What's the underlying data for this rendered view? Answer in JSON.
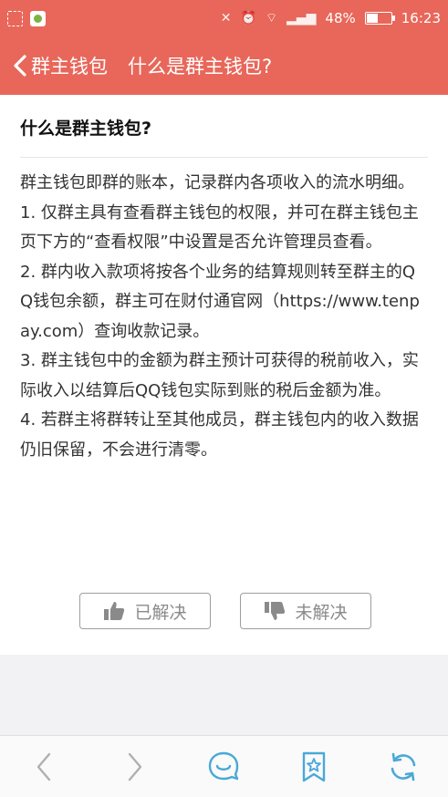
{
  "status_bar": {
    "battery": "48%",
    "battery_level": 0.48,
    "time": "16:23"
  },
  "nav": {
    "back_label": "群主钱包",
    "title": "什么是群主钱包?"
  },
  "article": {
    "title": "什么是群主钱包?",
    "paragraphs": [
      "群主钱包即群的账本，记录群内各项收入的流水明细。",
      "1. 仅群主具有查看群主钱包的权限，并可在群主钱包主页下方的“查看权限”中设置是否允许管理员查看。",
      "2. 群内收入款项将按各个业务的结算规则转至群主的QQ钱包余额，群主可在财付通官网（https://www.tenpay.com）查询收款记录。",
      "3. 群主钱包中的金额为群主预计可获得的税前收入，实际收入以结算后QQ钱包实际到账的税后金额为准。",
      "4. 若群主将群转让至其他成员，群主钱包内的收入数据仍旧保留，不会进行清零。"
    ]
  },
  "feedback": {
    "solved_label": "已解决",
    "unsolved_label": "未解决"
  },
  "colors": {
    "header": "#e8675a",
    "toolbar_icon": "#4aa8d8",
    "toolbar_icon_disabled": "#b0b0b0"
  }
}
